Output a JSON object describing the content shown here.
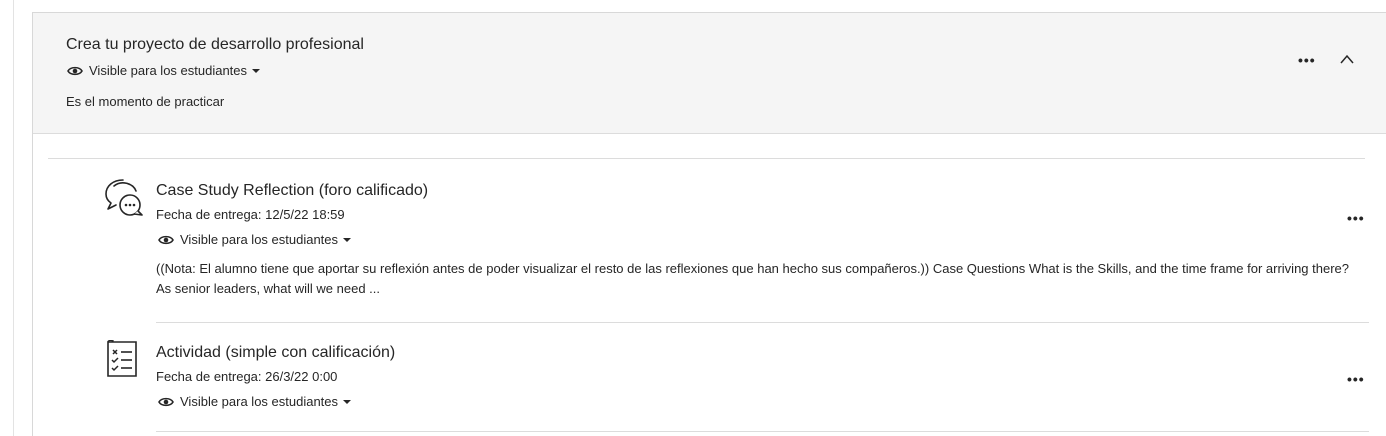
{
  "module": {
    "title": "Crea tu proyecto de desarrollo profesional",
    "visibility": "Visible para los estudiantes",
    "description": "Es el momento de practicar",
    "more_label": "•••"
  },
  "items": [
    {
      "title": "Case Study Reflection (foro calificado)",
      "due": "Fecha de entrega: 12/5/22 18:59",
      "visibility": "Visible para los estudiantes",
      "description": "((Nota: El alumno tiene que aportar su reflexión antes de poder visualizar el resto de las reflexiones que han hecho sus compañeros.)) Case Questions What is the Skills, and the time frame for arriving there? As senior leaders, what will we need ...",
      "icon": "discussion-icon",
      "more_label": "•••"
    },
    {
      "title": "Actividad (simple con calificación)",
      "due": "Fecha de entrega: 26/3/22 0:00",
      "visibility": "Visible para los estudiantes",
      "icon": "assignment-icon",
      "more_label": "•••"
    }
  ],
  "colors": {
    "text": "#262626",
    "header_bg": "#f5f5f5",
    "border": "#dcdcdc"
  }
}
